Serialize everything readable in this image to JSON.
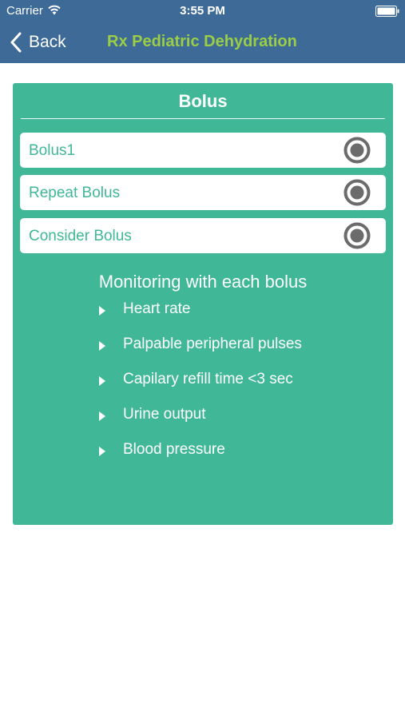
{
  "status_bar": {
    "carrier": "Carrier",
    "time": "3:55 PM",
    "wifi_icon": "wifi-icon",
    "battery_icon": "battery-icon"
  },
  "nav": {
    "back_label": "Back",
    "back_icon": "chevron-left-icon",
    "title": "Rx Pediatric Dehydration"
  },
  "card": {
    "title": "Bolus",
    "options": [
      {
        "label": "Bolus1",
        "icon": "radio-selected-icon"
      },
      {
        "label": "Repeat Bolus",
        "icon": "radio-selected-icon"
      },
      {
        "label": "Consider Bolus",
        "icon": "radio-selected-icon"
      }
    ],
    "monitor_heading": "Monitoring with each bolus",
    "monitor_items": [
      "Heart rate",
      "Palpable peripheral pulses",
      "Capilary refill time <3 sec",
      "Urine output",
      "Blood pressure"
    ]
  },
  "colors": {
    "header_bg": "#3d6a96",
    "title_green": "#9ccd46",
    "card_bg": "#40b897",
    "radio_gray": "#6b6b6b",
    "page_bg": "#ffffff"
  }
}
